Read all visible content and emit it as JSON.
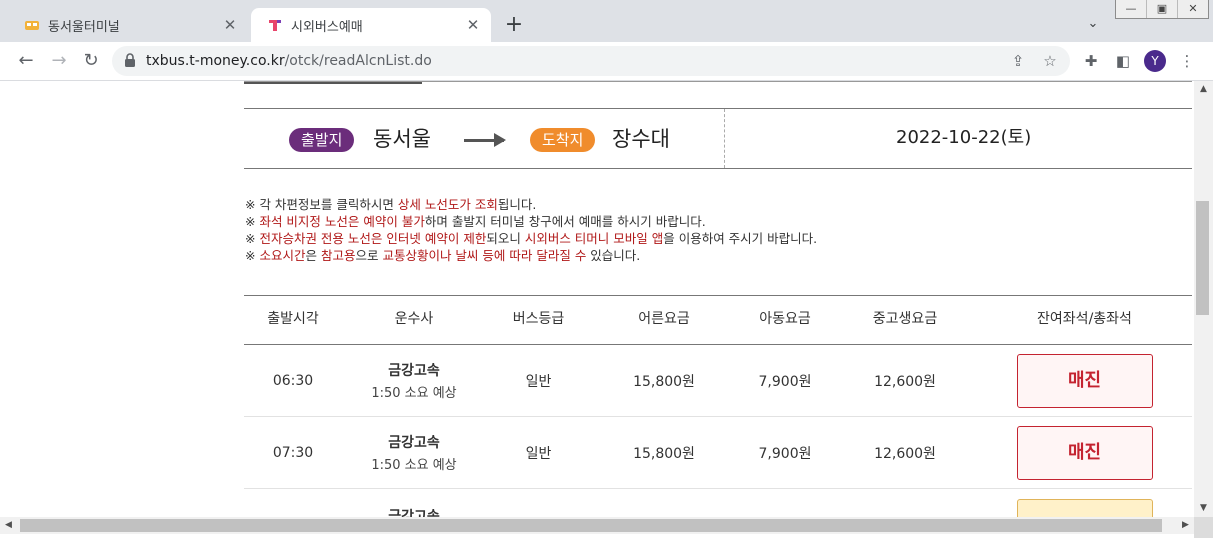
{
  "browser": {
    "tabs": [
      {
        "title": "동서울터미널",
        "active": false
      },
      {
        "title": "시외버스예매",
        "active": true
      }
    ],
    "url_host": "txbus.t-money.co.kr",
    "url_path": "/otck/readAlcnList.do",
    "avatar_letter": "Y",
    "icons": [
      "back-icon",
      "forward-icon",
      "reload-icon",
      "lock-icon",
      "share-icon",
      "star-icon",
      "extensions-icon",
      "sidepanel-icon",
      "menu-icon"
    ]
  },
  "route": {
    "departure_tag": "출발지",
    "departure": "동서울",
    "arrival_tag": "도착지",
    "arrival": "장수대",
    "date": "2022-10-22(토)"
  },
  "notices": [
    [
      {
        "t": "※ 각 차편정보를 클릭하시면 "
      },
      {
        "t": "상세 노선도가 조회",
        "hl": true
      },
      {
        "t": "됩니다."
      }
    ],
    [
      {
        "t": "※ "
      },
      {
        "t": "좌석 비지정 노선은 예약이 불가",
        "hl": true
      },
      {
        "t": "하며 출발지 터미널 창구에서 예매를 하시기 바랍니다."
      }
    ],
    [
      {
        "t": "※ "
      },
      {
        "t": "전자승차권 전용 노선은 인터넷 예약이 제한",
        "hl": true
      },
      {
        "t": "되오니 "
      },
      {
        "t": "시외버스 티머니 모바일 앱",
        "hl": true
      },
      {
        "t": "을 이용하여 주시기 바랍니다."
      }
    ],
    [
      {
        "t": "※ "
      },
      {
        "t": "소요시간",
        "hl": true
      },
      {
        "t": "은 "
      },
      {
        "t": "참고용",
        "hl": true
      },
      {
        "t": "으로 "
      },
      {
        "t": "교통상황이나 날씨 등에 따라 달라질 수",
        "hl": true
      },
      {
        "t": " 있습니다."
      }
    ]
  ],
  "table": {
    "headers": {
      "time": "출발시각",
      "company": "운수사",
      "grade": "버스등급",
      "adult": "어른요금",
      "child": "아동요금",
      "teen": "중고생요금",
      "seats": "잔여좌석/총좌석"
    },
    "rows": [
      {
        "time": "06:30",
        "company": "금강고속",
        "duration": "1:50 소요 예상",
        "grade": "일반",
        "adult": "15,800원",
        "child": "7,900원",
        "teen": "12,600원",
        "seats": "매진"
      },
      {
        "time": "07:30",
        "company": "금강고속",
        "duration": "1:50 소요 예상",
        "grade": "일반",
        "adult": "15,800원",
        "child": "7,900원",
        "teen": "12,600원",
        "seats": "매진"
      },
      {
        "time": "",
        "company": "금강고속",
        "duration": "",
        "grade": "",
        "adult": "",
        "child": "",
        "teen": "",
        "seats": ""
      }
    ]
  },
  "colors": {
    "departure_pill": "#6b2d7b",
    "arrival_pill": "#f08c2c",
    "highlight_text": "#b01818",
    "soldout": "#c42330"
  }
}
